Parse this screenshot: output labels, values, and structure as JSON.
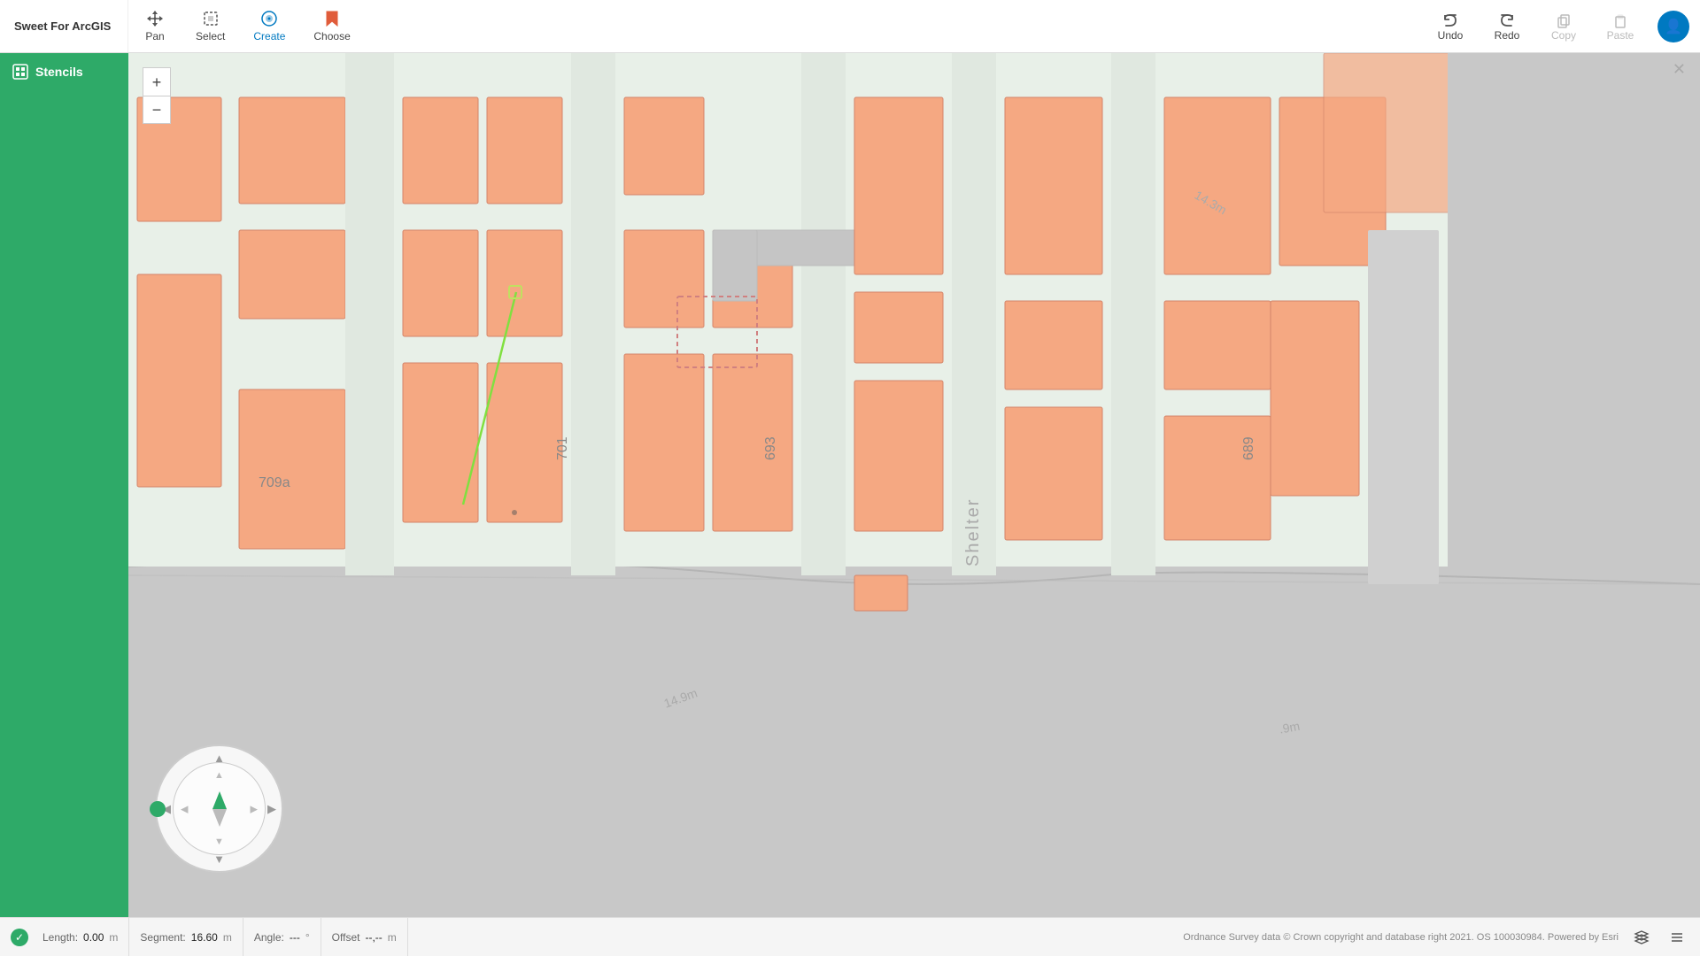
{
  "app": {
    "title": "Sweet For ArcGIS"
  },
  "toolbar": {
    "pan_label": "Pan",
    "select_label": "Select",
    "create_label": "Create",
    "choose_label": "Choose",
    "undo_label": "Undo",
    "redo_label": "Redo",
    "copy_label": "Copy",
    "paste_label": "Paste"
  },
  "sidebar": {
    "title": "Stencils"
  },
  "statusbar": {
    "length_label": "Length:",
    "length_value": "0.00",
    "length_unit": "m",
    "segment_label": "Segment:",
    "segment_value": "16.60",
    "segment_unit": "m",
    "angle_label": "Angle:",
    "angle_value": "---",
    "angle_unit": "°",
    "offset_label": "Offset",
    "offset_value": "--,--",
    "offset_unit": "m",
    "attribution": "Ordnance Survey data © Crown copyright and database right 2021. OS 100030984.    Powered by Esri"
  },
  "map": {
    "buildings": [
      "709a",
      "701",
      "693",
      "689"
    ],
    "distance_labels": [
      "14.3m",
      "14.9m",
      "9m"
    ],
    "street": "Shelter"
  }
}
